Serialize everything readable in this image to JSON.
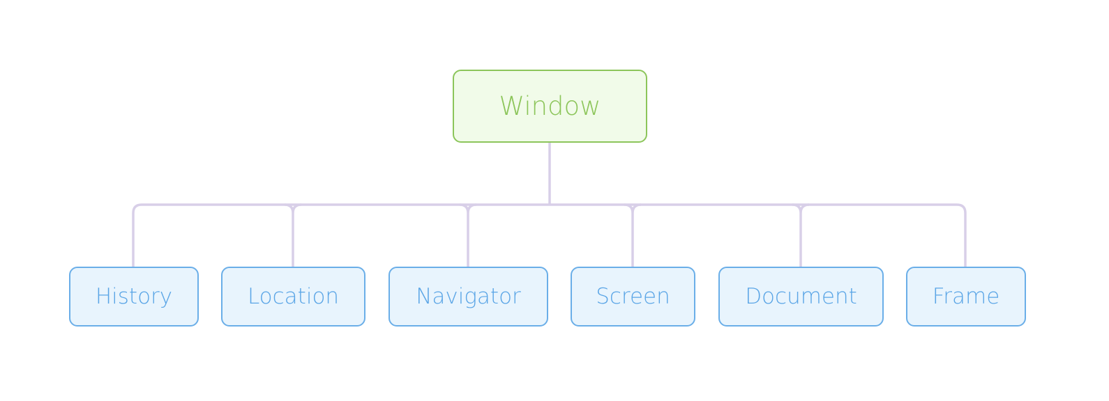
{
  "root": {
    "label": "Window"
  },
  "children": [
    {
      "label": "History"
    },
    {
      "label": "Location"
    },
    {
      "label": "Navigator"
    },
    {
      "label": "Screen"
    },
    {
      "label": "Document"
    },
    {
      "label": "Frame"
    }
  ],
  "colors": {
    "root_fill": "#f1fbe9",
    "root_stroke": "#8cc55a",
    "child_fill": "#e8f4fd",
    "child_stroke": "#6aaee8",
    "connector": "#d8cfe8"
  }
}
